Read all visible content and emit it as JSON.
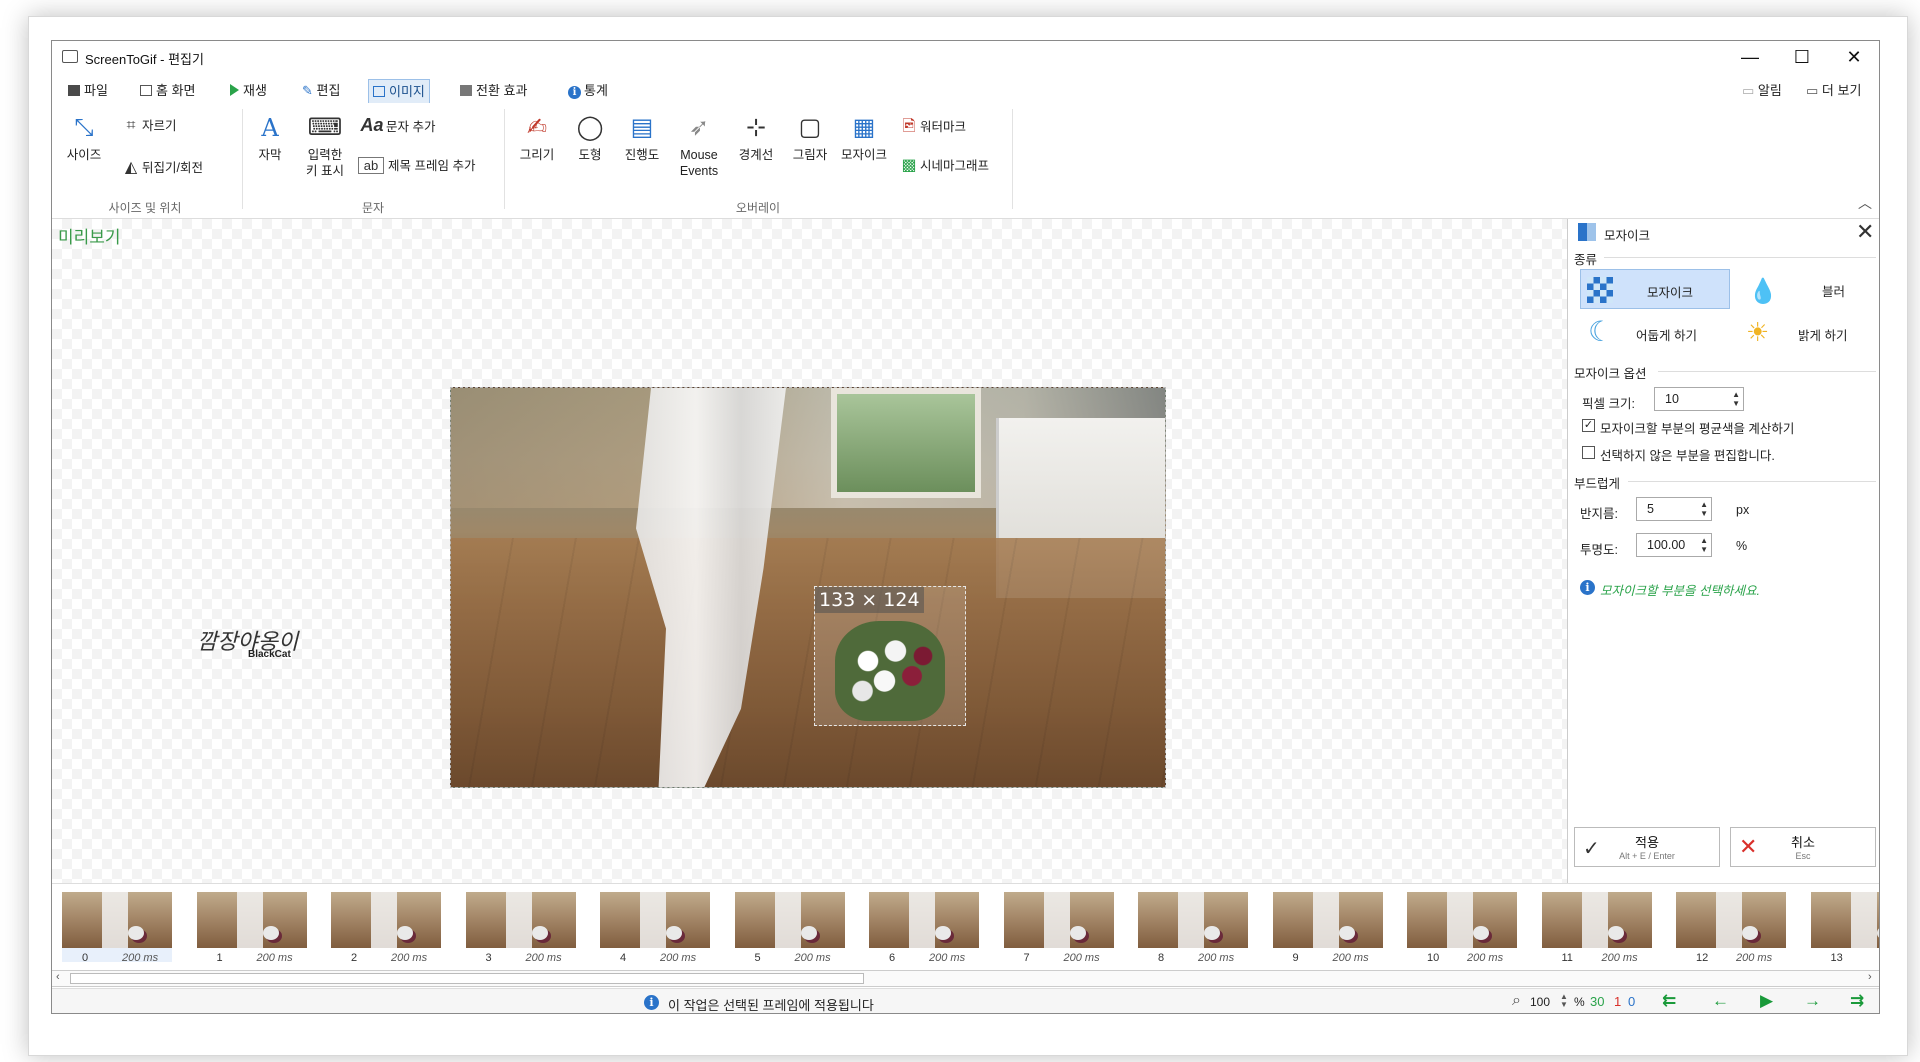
{
  "window": {
    "title": "ScreenToGif - 편집기",
    "controls": [
      "—",
      "☐",
      "✕"
    ]
  },
  "tabs": [
    {
      "label": "파일"
    },
    {
      "label": "홈 화면"
    },
    {
      "label": "재생"
    },
    {
      "label": "편집"
    },
    {
      "label": "이미지"
    },
    {
      "label": "전환 효과"
    },
    {
      "label": "통계"
    }
  ],
  "topright": {
    "notify": "알림",
    "more": "더 보기"
  },
  "ribbon": {
    "size": "사이즈",
    "crop": "자르기",
    "flip": "뒤집기/회전",
    "group_size": "사이즈 및 위치",
    "caption": "자막",
    "keys_l1": "입력한",
    "keys_l2": "키 표시",
    "addtext": "문자 추가",
    "titleframe": "제목 프레임 추가",
    "group_text": "문자",
    "draw": "그리기",
    "shape": "도형",
    "progress": "진행도",
    "mouse_l1": "Mouse",
    "mouse_l2": "Events",
    "border": "경계선",
    "shadow": "그림자",
    "mosaic": "모자이크",
    "watermark": "워터마크",
    "cinemagraph": "시네마그래프",
    "group_overlay": "오버레이"
  },
  "preview": {
    "title": "미리보기",
    "selection": "133 × 124",
    "watermark1": "깜장야옹이",
    "watermark2": "BlackCat"
  },
  "panel": {
    "title": "모자이크",
    "type_label": "종류",
    "types": {
      "mosaic": "모자이크",
      "blur": "블러",
      "darken": "어둡게 하기",
      "lighten": "밝게 하기"
    },
    "options_label": "모자이크 옵션",
    "pixel_label": "픽셀 크기:",
    "pixel_value": "10",
    "avg_color": "모자이크할 부분의 평균색을 계산하기",
    "edit_unselected": "선택하지 않은 부분을 편집합니다.",
    "smooth_label": "부드럽게",
    "radius_label": "반지름:",
    "radius_value": "5",
    "radius_unit": "px",
    "opacity_label": "투명도:",
    "opacity_value": "100.00",
    "opacity_unit": "%",
    "hint": "모자이크할 부분을 선택하세요.",
    "apply": "적용",
    "apply_sc": "Alt + E / Enter",
    "cancel": "취소",
    "cancel_sc": "Esc",
    "avg_checked": true,
    "edit_checked": false
  },
  "frames": [
    {
      "n": "0",
      "ms": "200 ms"
    },
    {
      "n": "1",
      "ms": "200 ms"
    },
    {
      "n": "2",
      "ms": "200 ms"
    },
    {
      "n": "3",
      "ms": "200 ms"
    },
    {
      "n": "4",
      "ms": "200 ms"
    },
    {
      "n": "5",
      "ms": "200 ms"
    },
    {
      "n": "6",
      "ms": "200 ms"
    },
    {
      "n": "7",
      "ms": "200 ms"
    },
    {
      "n": "8",
      "ms": "200 ms"
    },
    {
      "n": "9",
      "ms": "200 ms"
    },
    {
      "n": "10",
      "ms": "200 ms"
    },
    {
      "n": "11",
      "ms": "200 ms"
    },
    {
      "n": "12",
      "ms": "200 ms"
    },
    {
      "n": "13",
      "ms": ""
    }
  ],
  "status": {
    "message": "이 작업은 선택된 프레임에 적용됩니다",
    "zoom": "100",
    "zoom_unit": "%",
    "total": "30",
    "selected": "1",
    "current": "0"
  },
  "colors": {
    "accent": "#2a73c9",
    "green": "#3a9a4a",
    "selected_bg": "#cfe2fb"
  }
}
